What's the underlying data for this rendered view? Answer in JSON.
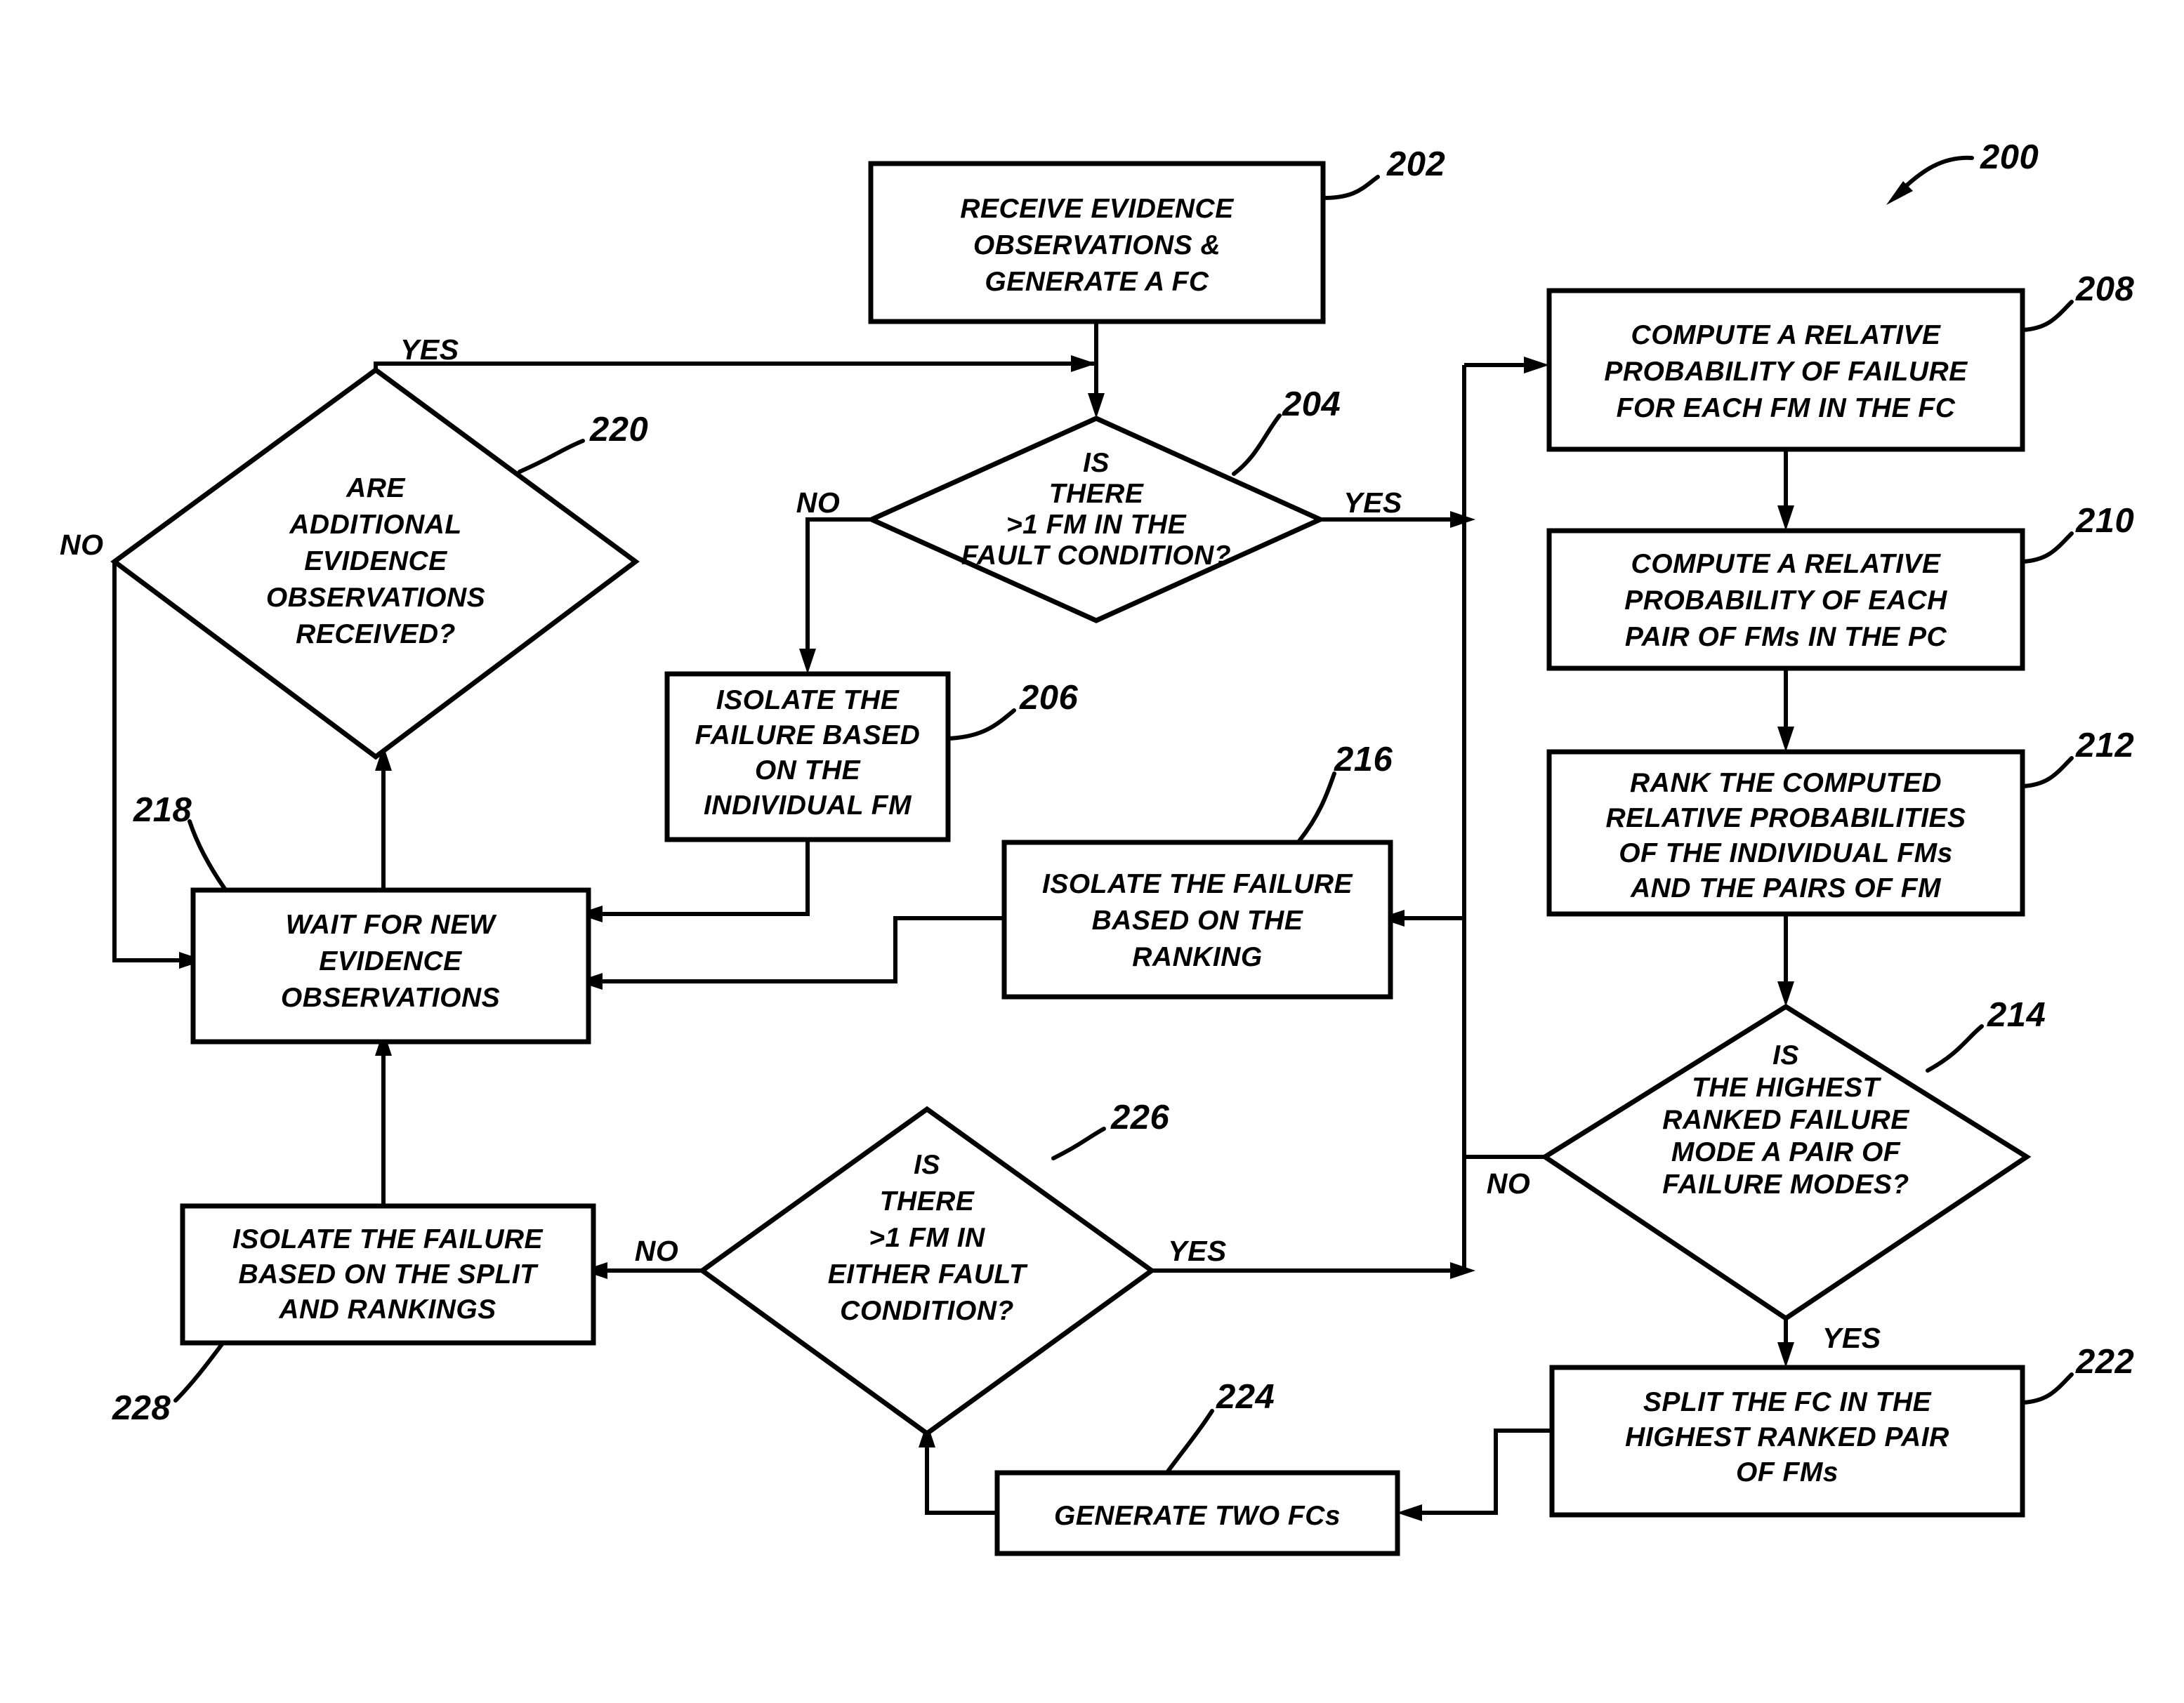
{
  "figure": {
    "reference_numeral": "200",
    "type": "flowchart"
  },
  "nodes": {
    "n202": {
      "ref": "202",
      "shape": "process",
      "lines": [
        "RECEIVE EVIDENCE",
        "OBSERVATIONS &",
        "GENERATE A FC"
      ]
    },
    "n204": {
      "ref": "204",
      "shape": "decision",
      "lines": [
        "IS",
        "THERE",
        ">1 FM IN THE",
        "FAULT CONDITION?"
      ],
      "branch_no": "NO",
      "branch_yes": "YES"
    },
    "n206": {
      "ref": "206",
      "shape": "process",
      "lines": [
        "ISOLATE THE",
        "FAILURE BASED",
        "ON THE",
        "INDIVIDUAL FM"
      ]
    },
    "n208": {
      "ref": "208",
      "shape": "process",
      "lines": [
        "COMPUTE A RELATIVE",
        "PROBABILITY OF FAILURE",
        "FOR EACH FM IN THE FC"
      ]
    },
    "n210": {
      "ref": "210",
      "shape": "process",
      "lines": [
        "COMPUTE A RELATIVE",
        "PROBABILITY OF EACH",
        "PAIR OF FMs IN THE PC"
      ]
    },
    "n212": {
      "ref": "212",
      "shape": "process",
      "lines": [
        "RANK THE COMPUTED",
        "RELATIVE PROBABILITIES",
        "OF THE INDIVIDUAL FMs",
        "AND THE PAIRS OF FM"
      ]
    },
    "n214": {
      "ref": "214",
      "shape": "decision",
      "lines": [
        "IS",
        "THE HIGHEST",
        "RANKED FAILURE",
        "MODE A PAIR OF",
        "FAILURE MODES?"
      ],
      "branch_no": "NO",
      "branch_yes": "YES"
    },
    "n216": {
      "ref": "216",
      "shape": "process",
      "lines": [
        "ISOLATE THE FAILURE",
        "BASED ON THE",
        "RANKING"
      ]
    },
    "n218": {
      "ref": "218",
      "shape": "process",
      "lines": [
        "WAIT FOR NEW",
        "EVIDENCE",
        "OBSERVATIONS"
      ]
    },
    "n220": {
      "ref": "220",
      "shape": "decision",
      "lines": [
        "ARE",
        "ADDITIONAL",
        "EVIDENCE",
        "OBSERVATIONS",
        "RECEIVED?"
      ],
      "branch_no": "NO",
      "branch_yes": "YES"
    },
    "n222": {
      "ref": "222",
      "shape": "process",
      "lines": [
        "SPLIT THE FC IN THE",
        "HIGHEST RANKED PAIR",
        "OF FMs"
      ]
    },
    "n224": {
      "ref": "224",
      "shape": "process",
      "lines": [
        "GENERATE TWO FCs"
      ]
    },
    "n226": {
      "ref": "226",
      "shape": "decision",
      "lines": [
        "IS",
        "THERE",
        ">1 FM IN",
        "EITHER FAULT",
        "CONDITION?"
      ],
      "branch_no": "NO",
      "branch_yes": "YES"
    },
    "n228": {
      "ref": "228",
      "shape": "process",
      "lines": [
        "ISOLATE THE FAILURE",
        "BASED ON THE SPLIT",
        "AND RANKINGS"
      ]
    }
  },
  "colors": {
    "ink": "#000000",
    "paper": "#ffffff"
  }
}
